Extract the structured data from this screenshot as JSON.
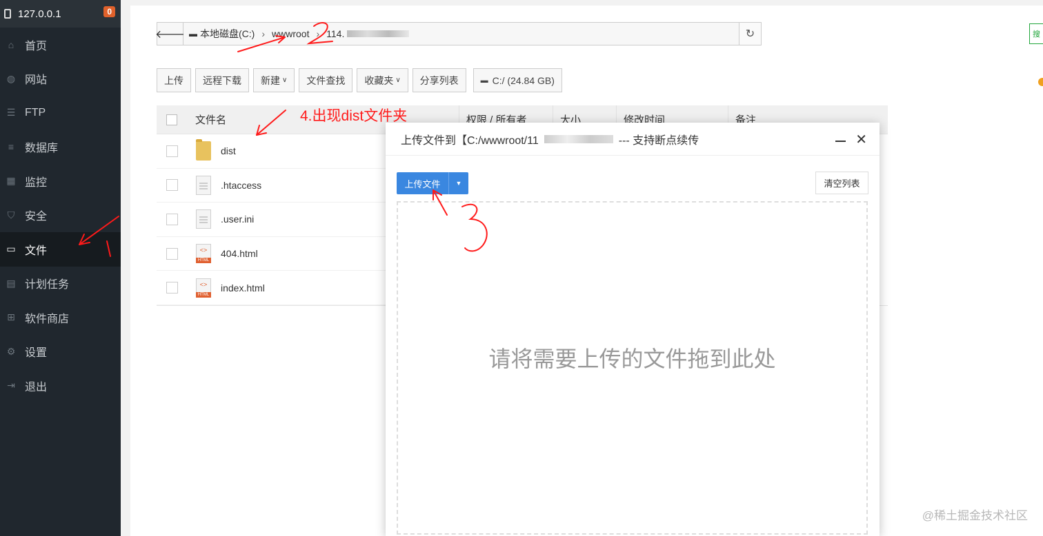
{
  "sidebar": {
    "server": "127.0.0.1",
    "badge": "0",
    "items": [
      {
        "label": "首页",
        "icon": "home-icon"
      },
      {
        "label": "网站",
        "icon": "globe-icon"
      },
      {
        "label": "FTP",
        "icon": "ftp-icon"
      },
      {
        "label": "数据库",
        "icon": "database-icon"
      },
      {
        "label": "监控",
        "icon": "monitor-icon"
      },
      {
        "label": "安全",
        "icon": "shield-icon"
      },
      {
        "label": "文件",
        "icon": "folder-icon",
        "active": true
      },
      {
        "label": "计划任务",
        "icon": "calendar-icon"
      },
      {
        "label": "软件商店",
        "icon": "grid-icon"
      },
      {
        "label": "设置",
        "icon": "gear-icon"
      },
      {
        "label": "退出",
        "icon": "logout-icon"
      }
    ]
  },
  "path": {
    "drive": "本地磁盘(C:)",
    "folder": "wwwroot",
    "sub": "114."
  },
  "search_stub": "搜",
  "toolbar": {
    "upload": "上传",
    "remote_download": "远程下载",
    "new": "新建",
    "find": "文件查找",
    "favorites": "收藏夹",
    "share_list": "分享列表",
    "disk": "C:/ (24.84 GB)"
  },
  "table": {
    "headers": {
      "name": "文件名",
      "perm": "权限 / 所有者",
      "size": "大小",
      "mtime": "修改时间",
      "note": "备注"
    },
    "files": [
      {
        "name": "dist",
        "type": "folder"
      },
      {
        "name": ".htaccess",
        "type": "doc"
      },
      {
        "name": ".user.ini",
        "type": "doc"
      },
      {
        "name": "404.html",
        "type": "html"
      },
      {
        "name": "index.html",
        "type": "html"
      }
    ]
  },
  "modal": {
    "title_prefix": "上传文件到【C:/wwwroot/11",
    "title_suffix": "--- 支持断点续传",
    "upload_button": "上传文件",
    "clear_button": "清空列表",
    "drop_hint": "请将需要上传的文件拖到此处"
  },
  "annotations": {
    "step4": "4.出现dist文件夹"
  },
  "watermark": "@稀土掘金技术社区"
}
